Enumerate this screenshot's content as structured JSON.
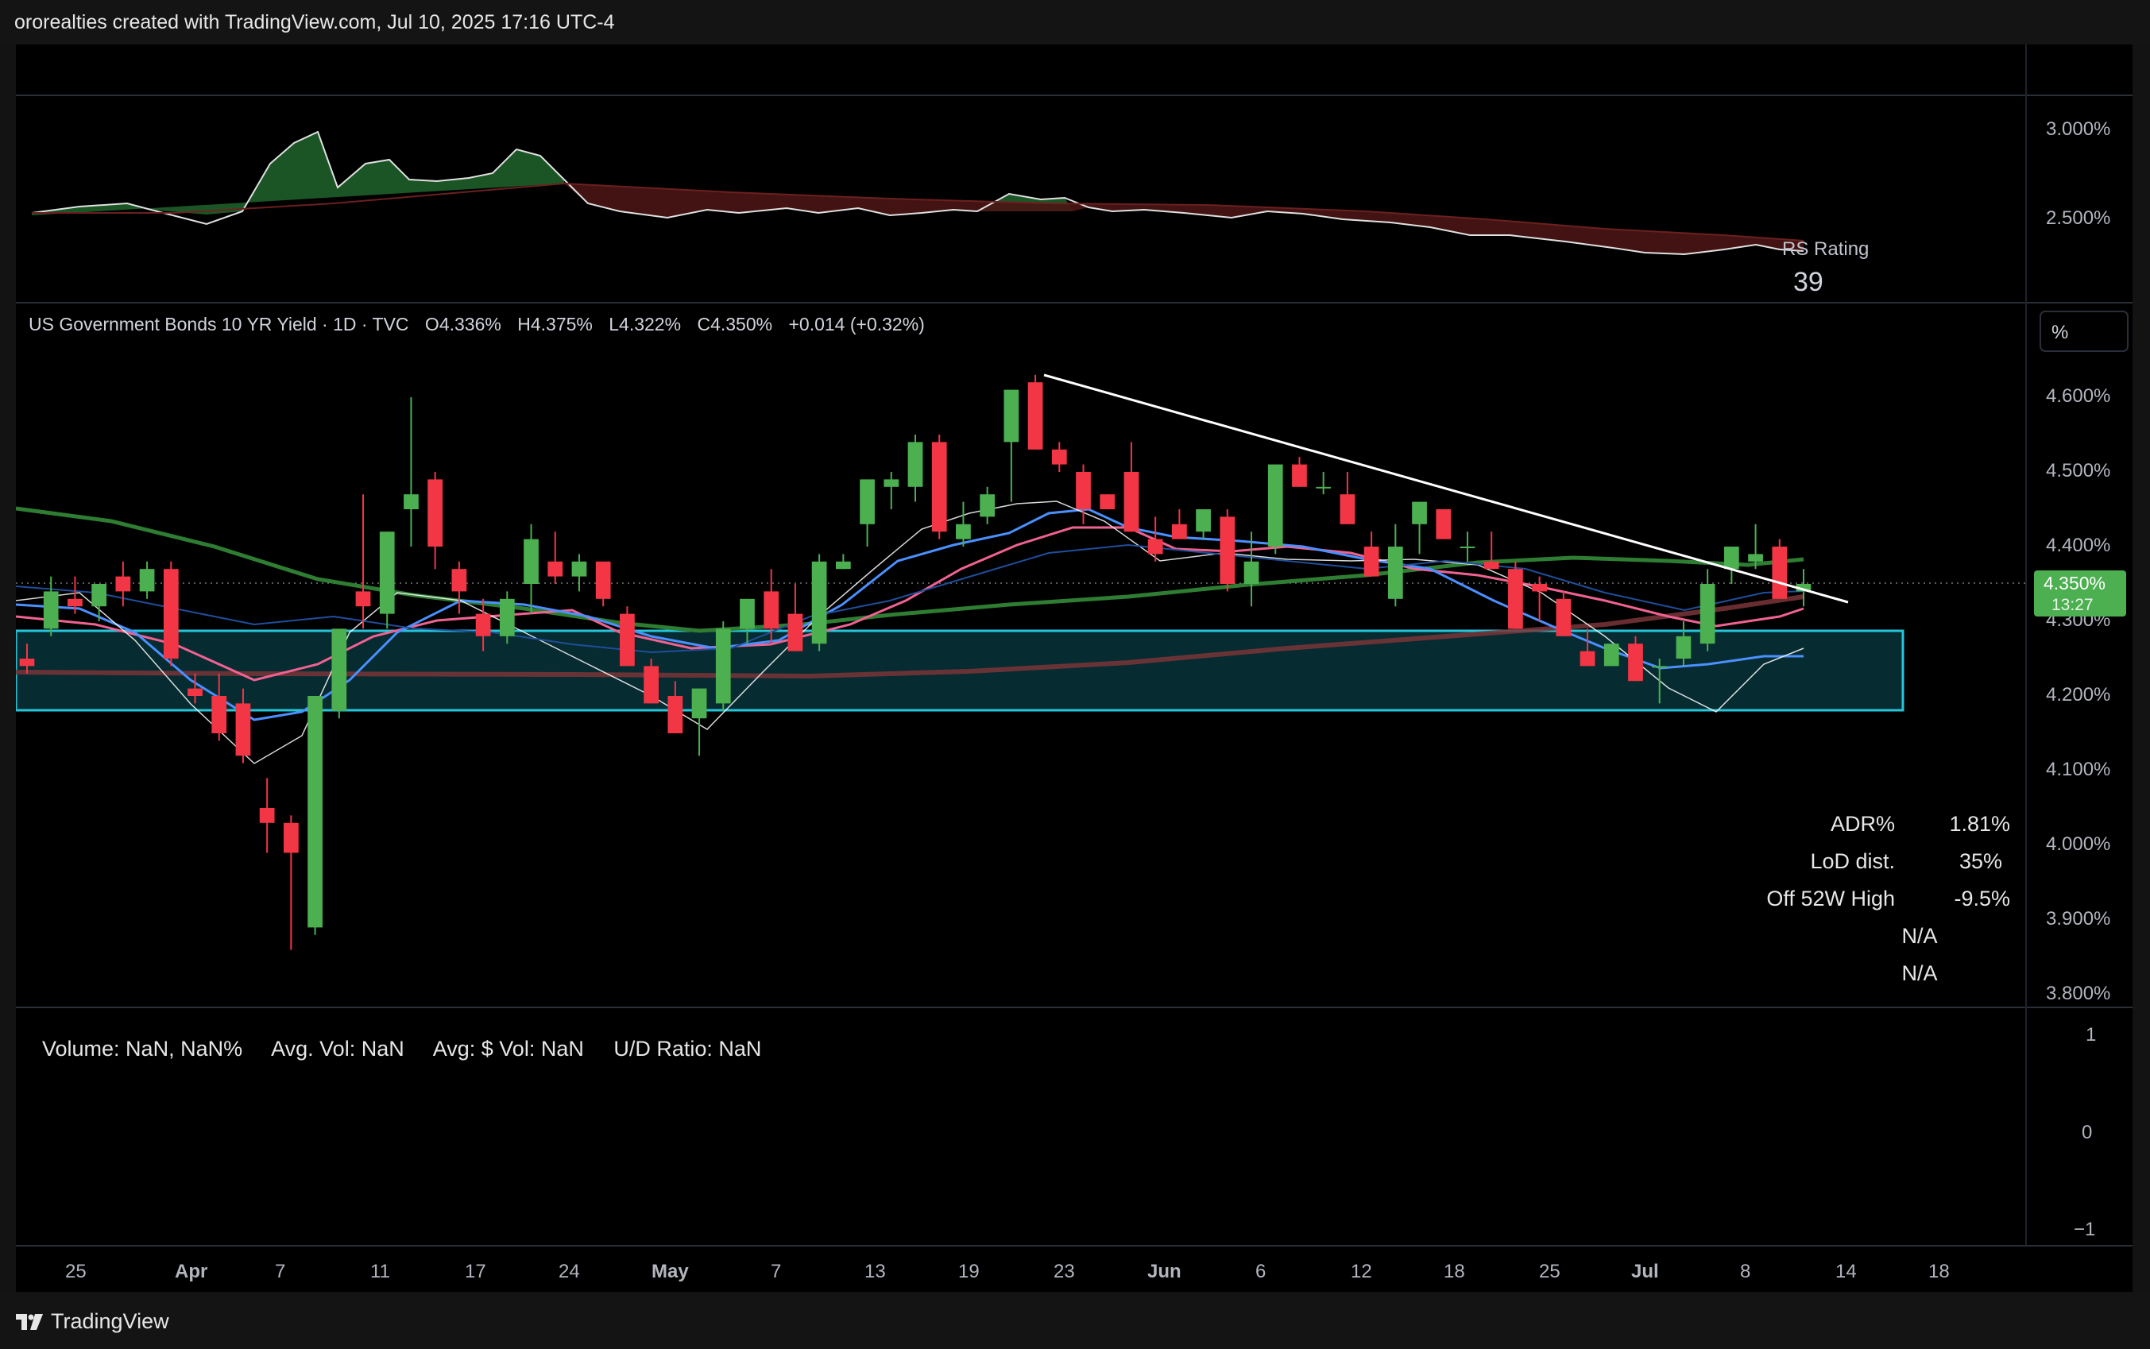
{
  "header": {
    "title": "ororealties created with TradingView.com, Jul 10, 2025 17:16 UTC-4"
  },
  "footer": {
    "brand": "TradingView"
  },
  "colors": {
    "bull": "#4caf50",
    "bear": "#f23645",
    "cyan": "#00e5ff",
    "zone": "#26c6da",
    "ema_fast": "#2962ff",
    "ema_slow": "#f06292",
    "sma50": "#388e3c",
    "sma200": "#8d3b3b"
  },
  "rs_pane": {
    "label": "RS Rating",
    "value": "39",
    "ticks": [
      "3.000%",
      "2.500%"
    ]
  },
  "main_pane": {
    "legend": {
      "symbol": "US Government Bonds 10 YR Yield · 1D · TVC",
      "o_label": "O",
      "o": "4.336%",
      "h_label": "H",
      "h": "4.375%",
      "l_label": "L",
      "l": "4.322%",
      "c_label": "C",
      "c": "4.350%",
      "change": "+0.014 (+0.32%)"
    },
    "scale_button": "%",
    "price_tag": {
      "price": "4.350%",
      "countdown": "13:27"
    },
    "ticks": [
      "4.600%",
      "4.500%",
      "4.400%",
      "4.300%",
      "4.200%",
      "4.100%",
      "4.000%",
      "3.900%",
      "3.800%"
    ],
    "stats": [
      {
        "label": "ADR%",
        "value": "1.81%"
      },
      {
        "label": "LoD dist.",
        "value": "35%"
      },
      {
        "label": "Off 52W High",
        "value": "-9.5%"
      },
      {
        "label": "N/A",
        "value": ""
      },
      {
        "label": "N/A",
        "value": ""
      }
    ]
  },
  "volume_pane": {
    "text": "Volume: NaN, NaN%     Avg. Vol: NaN     Avg: $ Vol: NaN     U/D Ratio: NaN",
    "ticks": [
      "1",
      "0",
      "−1"
    ]
  },
  "x_axis": {
    "labels": [
      {
        "text": "25",
        "bold": false
      },
      {
        "text": "Apr",
        "bold": true
      },
      {
        "text": "7",
        "bold": false
      },
      {
        "text": "11",
        "bold": false
      },
      {
        "text": "17",
        "bold": false
      },
      {
        "text": "24",
        "bold": false
      },
      {
        "text": "May",
        "bold": true
      },
      {
        "text": "7",
        "bold": false
      },
      {
        "text": "13",
        "bold": false
      },
      {
        "text": "19",
        "bold": false
      },
      {
        "text": "23",
        "bold": false
      },
      {
        "text": "Jun",
        "bold": true
      },
      {
        "text": "6",
        "bold": false
      },
      {
        "text": "12",
        "bold": false
      },
      {
        "text": "18",
        "bold": false
      },
      {
        "text": "25",
        "bold": false
      },
      {
        "text": "Jul",
        "bold": true
      },
      {
        "text": "8",
        "bold": false
      },
      {
        "text": "14",
        "bold": false
      },
      {
        "text": "18",
        "bold": false
      }
    ]
  },
  "chart_data": {
    "type": "candlestick",
    "title": "US Government Bonds 10 YR Yield · 1D · TVC",
    "ylim": [
      3.8,
      4.65
    ],
    "candles": [
      [
        4.25,
        4.27,
        4.23,
        4.24
      ],
      [
        4.29,
        4.36,
        4.28,
        4.34
      ],
      [
        4.33,
        4.36,
        4.31,
        4.32
      ],
      [
        4.32,
        4.34,
        4.3,
        4.35
      ],
      [
        4.36,
        4.38,
        4.32,
        4.34
      ],
      [
        4.34,
        4.38,
        4.33,
        4.37
      ],
      [
        4.37,
        4.38,
        4.24,
        4.25
      ],
      [
        4.21,
        4.23,
        4.19,
        4.2
      ],
      [
        4.2,
        4.23,
        4.14,
        4.15
      ],
      [
        4.19,
        4.21,
        4.11,
        4.12
      ],
      [
        4.05,
        4.09,
        3.99,
        4.03
      ],
      [
        4.03,
        4.04,
        3.86,
        3.99
      ],
      [
        3.89,
        4.2,
        3.88,
        4.2
      ],
      [
        4.18,
        4.29,
        4.17,
        4.29
      ],
      [
        4.34,
        4.47,
        4.29,
        4.32
      ],
      [
        4.31,
        4.42,
        4.29,
        4.42
      ],
      [
        4.45,
        4.6,
        4.4,
        4.47
      ],
      [
        4.49,
        4.5,
        4.37,
        4.4
      ],
      [
        4.37,
        4.38,
        4.31,
        4.34
      ],
      [
        4.31,
        4.33,
        4.26,
        4.28
      ],
      [
        4.28,
        4.34,
        4.27,
        4.33
      ],
      [
        4.35,
        4.43,
        4.31,
        4.41
      ],
      [
        4.38,
        4.42,
        4.35,
        4.36
      ],
      [
        4.36,
        4.39,
        4.34,
        4.38
      ],
      [
        4.38,
        4.37,
        4.32,
        4.33
      ],
      [
        4.31,
        4.32,
        4.27,
        4.24
      ],
      [
        4.24,
        4.25,
        4.19,
        4.19
      ],
      [
        4.2,
        4.22,
        4.15,
        4.15
      ],
      [
        4.17,
        4.21,
        4.12,
        4.21
      ],
      [
        4.19,
        4.3,
        4.18,
        4.29
      ],
      [
        4.29,
        4.32,
        4.27,
        4.33
      ],
      [
        4.34,
        4.37,
        4.27,
        4.29
      ],
      [
        4.31,
        4.35,
        4.29,
        4.26
      ],
      [
        4.27,
        4.39,
        4.26,
        4.38
      ],
      [
        4.37,
        4.39,
        4.37,
        4.38
      ],
      [
        4.43,
        4.48,
        4.4,
        4.49
      ],
      [
        4.48,
        4.5,
        4.45,
        4.49
      ],
      [
        4.48,
        4.55,
        4.46,
        4.54
      ],
      [
        4.54,
        4.55,
        4.41,
        4.42
      ],
      [
        4.41,
        4.46,
        4.4,
        4.43
      ],
      [
        4.44,
        4.48,
        4.43,
        4.47
      ],
      [
        4.54,
        4.61,
        4.46,
        4.61
      ],
      [
        4.62,
        4.63,
        4.53,
        4.53
      ],
      [
        4.53,
        4.54,
        4.5,
        4.51
      ],
      [
        4.5,
        4.51,
        4.43,
        4.45
      ],
      [
        4.47,
        4.47,
        4.45,
        4.45
      ],
      [
        4.5,
        4.54,
        4.42,
        4.42
      ],
      [
        4.41,
        4.44,
        4.38,
        4.39
      ],
      [
        4.43,
        4.45,
        4.41,
        4.41
      ],
      [
        4.42,
        4.43,
        4.41,
        4.45
      ],
      [
        4.44,
        4.45,
        4.34,
        4.35
      ],
      [
        4.35,
        4.42,
        4.32,
        4.38
      ],
      [
        4.4,
        4.51,
        4.39,
        4.51
      ],
      [
        4.51,
        4.52,
        4.48,
        4.48
      ],
      [
        4.48,
        4.5,
        4.47,
        4.48
      ],
      [
        4.47,
        4.5,
        4.43,
        4.43
      ],
      [
        4.4,
        4.42,
        4.36,
        4.36
      ],
      [
        4.33,
        4.43,
        4.32,
        4.4
      ],
      [
        4.43,
        4.44,
        4.39,
        4.46
      ],
      [
        4.45,
        4.45,
        4.41,
        4.41
      ],
      [
        4.4,
        4.42,
        4.38,
        4.4
      ],
      [
        4.38,
        4.42,
        4.37,
        4.37
      ],
      [
        4.37,
        4.38,
        4.29,
        4.29
      ],
      [
        4.35,
        4.36,
        4.3,
        4.34
      ],
      [
        4.33,
        4.34,
        4.28,
        4.28
      ],
      [
        4.26,
        4.29,
        4.24,
        4.24
      ],
      [
        4.24,
        4.27,
        4.25,
        4.27
      ],
      [
        4.27,
        4.28,
        4.22,
        4.22
      ],
      [
        4.24,
        4.25,
        4.19,
        4.24
      ],
      [
        4.25,
        4.3,
        4.24,
        4.28
      ],
      [
        4.27,
        4.37,
        4.26,
        4.35
      ],
      [
        4.37,
        4.4,
        4.35,
        4.4
      ],
      [
        4.38,
        4.43,
        4.37,
        4.39
      ],
      [
        4.4,
        4.41,
        4.33,
        4.33
      ],
      [
        4.34,
        4.37,
        4.32,
        4.35
      ]
    ]
  }
}
